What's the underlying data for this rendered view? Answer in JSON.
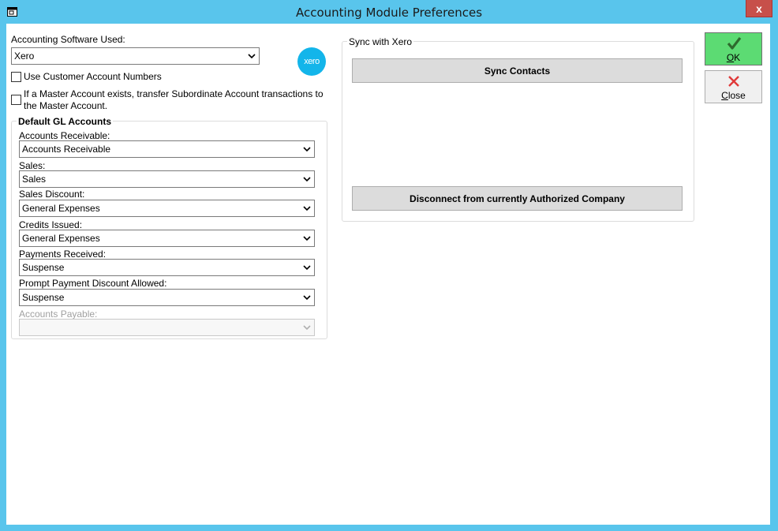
{
  "window": {
    "title": "Accounting Module Preferences",
    "close_glyph": "x",
    "colors": {
      "frame": "#59c5ec",
      "ok_green": "#5cdb73",
      "close_red": "#e03a3a",
      "xero_blue": "#13b5ea"
    }
  },
  "software": {
    "label": "Accounting Software Used:",
    "selected": "Xero",
    "logo_text": "xero"
  },
  "options": {
    "customer_account_numbers": {
      "label": "Use Customer Account Numbers",
      "checked": false
    },
    "transfer_subordinate": {
      "label_line1": "If a Master Account exists, transfer Subordinate Account transactions to",
      "label_line2": "the Master Account.",
      "checked": false
    }
  },
  "gl": {
    "title": "Default GL Accounts",
    "accounts_receivable": {
      "label": "Accounts Receivable:",
      "value": "Accounts Receivable"
    },
    "sales": {
      "label": "Sales:",
      "value": "Sales"
    },
    "sales_discount": {
      "label": "Sales Discount:",
      "value": "General Expenses"
    },
    "credits_issued": {
      "label": "Credits Issued:",
      "value": "General Expenses"
    },
    "payments_received": {
      "label": "Payments Received:",
      "value": "Suspense"
    },
    "prompt_payment": {
      "label": "Prompt Payment Discount Allowed:",
      "value": "Suspense"
    },
    "accounts_payable": {
      "label": "Accounts Payable:",
      "value": ""
    }
  },
  "sync": {
    "title": "Sync with Xero",
    "sync_contacts": "Sync Contacts",
    "disconnect": "Disconnect from currently Authorized Company"
  },
  "buttons": {
    "ok": "OK",
    "close": "Close",
    "ok_icon": "checkmark-icon",
    "close_icon": "x-mark-icon"
  }
}
